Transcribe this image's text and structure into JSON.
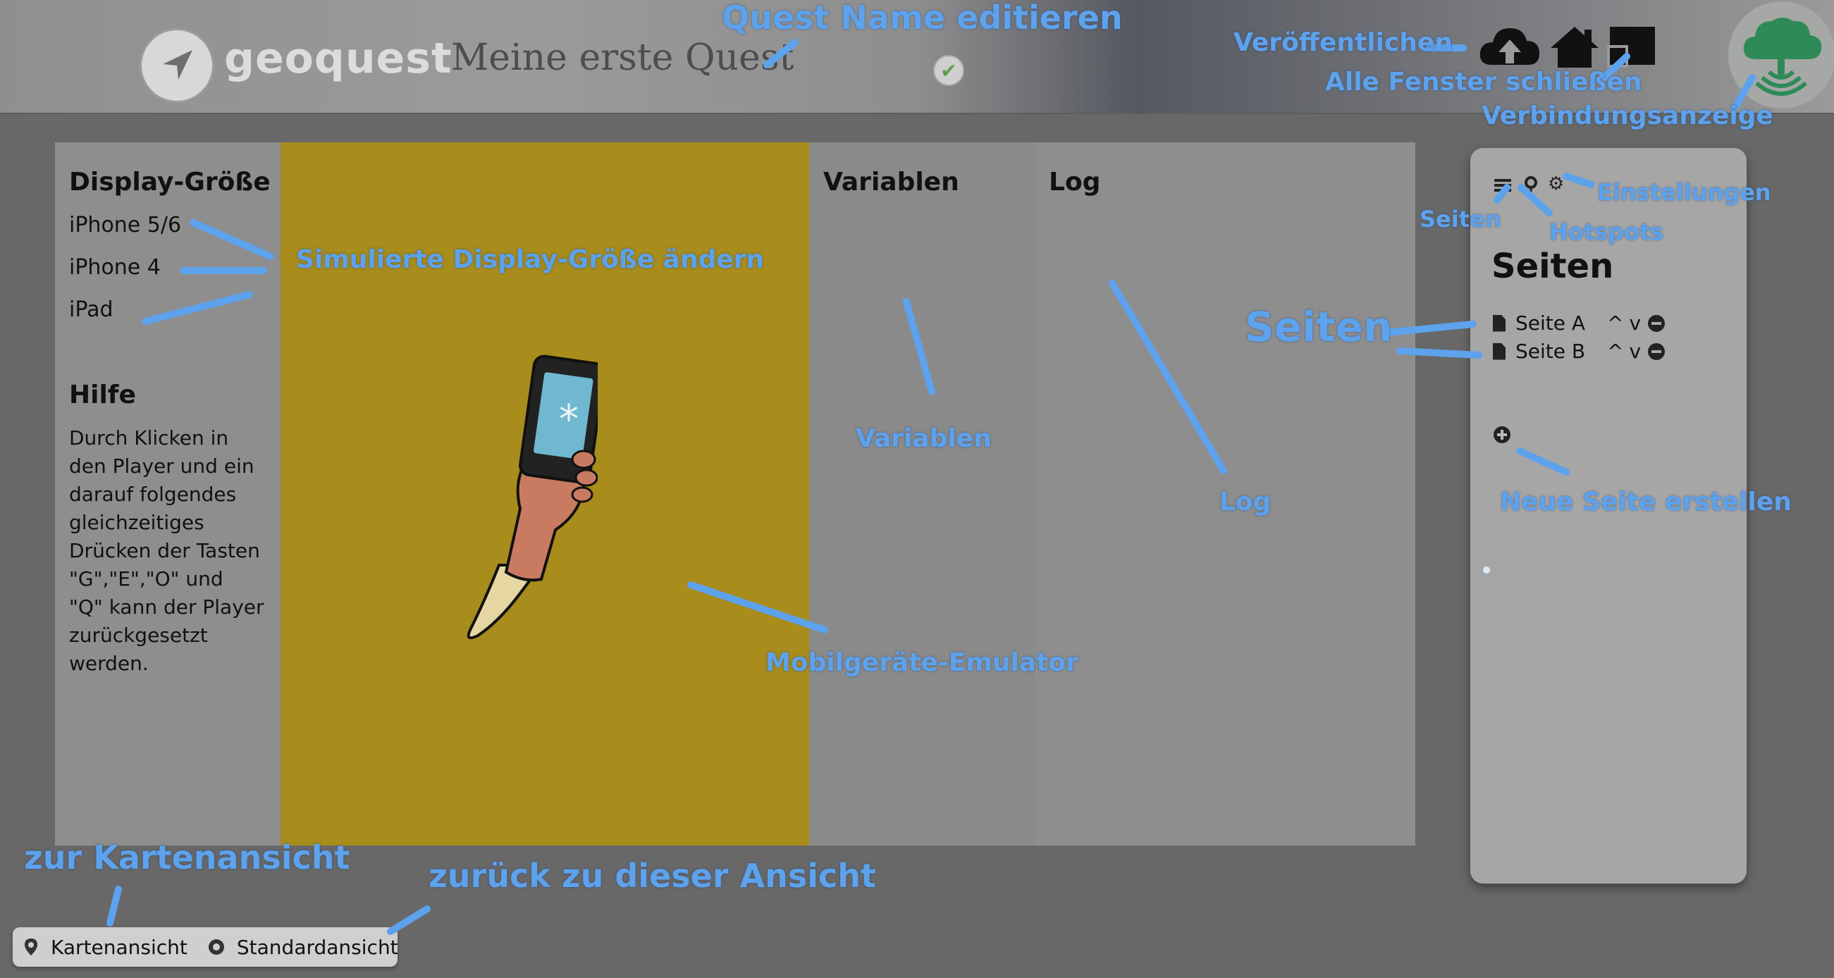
{
  "header": {
    "logo_text": "geoquest",
    "quest_title": "Meine erste Quest"
  },
  "toolbar": {
    "icons": [
      "publish-cloud-icon",
      "home-icon",
      "close-windows-icon"
    ]
  },
  "left_panel": {
    "display_title": "Display-Größe",
    "sizes": [
      "iPhone 5/6",
      "iPhone 4",
      "iPad"
    ],
    "help_title": "Hilfe",
    "help_lines": [
      "Durch Klicken in",
      "den Player und ein",
      "darauf folgendes",
      "gleichzeitiges",
      "Drücken der Tasten",
      "\"G\",\"E\",\"O\" und",
      "\"Q\" kann der Player",
      "zurückgesetzt",
      "werden."
    ]
  },
  "variables_panel": {
    "title": "Variablen"
  },
  "log_panel": {
    "title": "Log"
  },
  "pages_panel": {
    "title": "Seiten",
    "pages": [
      {
        "label": "Seite A",
        "up": "^",
        "down": "v"
      },
      {
        "label": "Seite B",
        "up": "^",
        "down": "v"
      }
    ]
  },
  "bottom_bar": {
    "map_view": "Kartenansicht",
    "default_view": "Standardansicht"
  },
  "annotations": {
    "quest_name": "Quest Name editieren",
    "publish": "Veröffentlichen",
    "close_windows": "Alle Fenster schließen",
    "connection": "Verbindungsanzeige",
    "display_size": "Simulierte Display-Größe ändern",
    "variables": "Variablen",
    "log": "Log",
    "emulator": "Mobilgeräte-Emulator",
    "pages_icon": "Seiten",
    "hotspots": "Hotspots",
    "settings": "Einstellungen",
    "pages_big": "Seiten",
    "new_page": "Neue Seite erstellen",
    "to_map": "zur Kartenansicht",
    "back": "zurück zu dieser Ansicht"
  },
  "colors": {
    "annotation": "#5da2ec",
    "emulator_bg": "#a88c1c",
    "background": "#686868"
  }
}
